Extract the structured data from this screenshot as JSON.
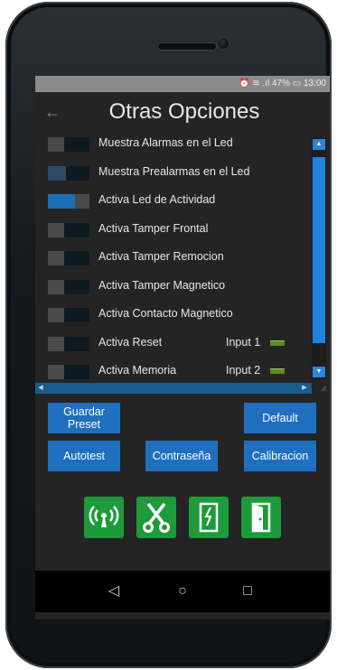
{
  "status_bar": {
    "text": "⏰ ≋ .ıl 47% ▭ 13:00"
  },
  "header": {
    "title": "Otras Opciones"
  },
  "options": [
    {
      "label": "Muestra Alarmas en el Led",
      "state": "off"
    },
    {
      "label": "Muestra Prealarmas en el Led",
      "state": "mid"
    },
    {
      "label": "Activa Led de Actividad",
      "state": "on"
    },
    {
      "label": "Activa Tamper Frontal",
      "state": "off"
    },
    {
      "label": "Activa Tamper Remocion",
      "state": "off"
    },
    {
      "label": "Activa Tamper Magnetico",
      "state": "off"
    },
    {
      "label": "Activa Contacto Magnetico",
      "state": "off"
    },
    {
      "label": "Activa Reset",
      "state": "off",
      "input": "Input 1"
    },
    {
      "label": "Activa Memoria",
      "state": "off",
      "input": "Input 2"
    }
  ],
  "buttons": {
    "guardar": "Guardar Preset",
    "default": "Default",
    "autotest": "Autotest",
    "password": "Contraseña",
    "calibracion": "Calibracion"
  },
  "colors": {
    "accent": "#1f6fbf",
    "icon_green": "#1d9a3a",
    "led_green": "#5a8a2a"
  },
  "icons": [
    "antenna-icon",
    "scissors-icon",
    "broken-panel-icon",
    "door-icon"
  ]
}
